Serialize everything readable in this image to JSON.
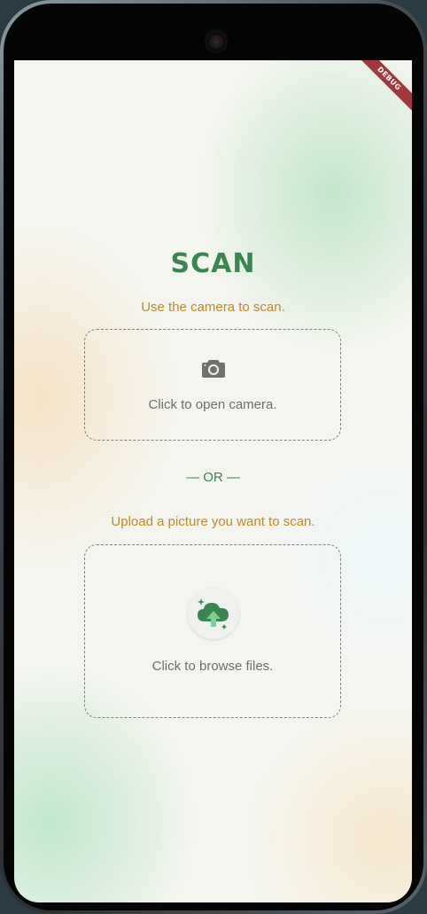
{
  "debug_banner": "DEBUG",
  "scan": {
    "title": "SCAN",
    "camera_hint": "Use the camera to scan.",
    "camera_box_label": "Click to open camera.",
    "or_label": "— OR —",
    "upload_hint": "Upload a picture you want to scan.",
    "upload_box_label": "Click to browse files."
  },
  "icons": {
    "camera": "camera-icon",
    "upload": "cloud-upload-icon"
  },
  "colors": {
    "accent_green": "#3a8650",
    "hint_orange": "#c08a2a",
    "label_gray": "#6e6e6e",
    "debug_red": "#a2383e"
  }
}
